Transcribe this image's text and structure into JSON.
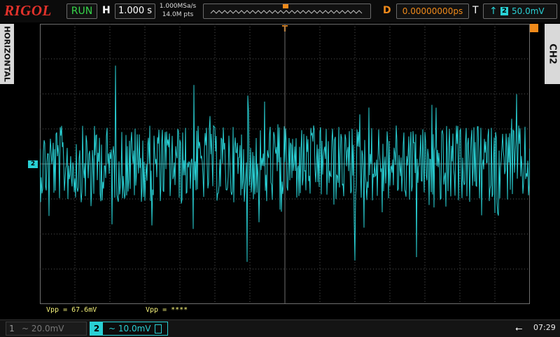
{
  "topbar": {
    "brand": "RIGOL",
    "run_status": "RUN",
    "horizontal_label": "H",
    "timebase": "1.000 s",
    "sample_rate": "1.000MSa/s",
    "memory_depth": "14.0M pts",
    "delay_label": "D",
    "delay_value": "0.00000000ps",
    "trigger_label": "T",
    "trigger_source": "2",
    "trigger_level": "50.0mV"
  },
  "side": {
    "left_tab": "HORIZONTAL",
    "right_tab": "CH2"
  },
  "channel_marker": "2",
  "measurements": {
    "vpp_ch2": "Vpp = 67.6mV",
    "vpp_ch1": "Vpp = ****"
  },
  "bottombar": {
    "ch1_number": "1",
    "ch1_scale": "~ 20.0mV",
    "ch2_number": "2",
    "ch2_scale": "~ 10.0mV",
    "time": "07:29"
  },
  "colors": {
    "ch2": "#29d0d4",
    "run": "#36d64a",
    "trigger": "#f08a1a",
    "brand": "#e3322b",
    "measure": "#f5f27a"
  }
}
